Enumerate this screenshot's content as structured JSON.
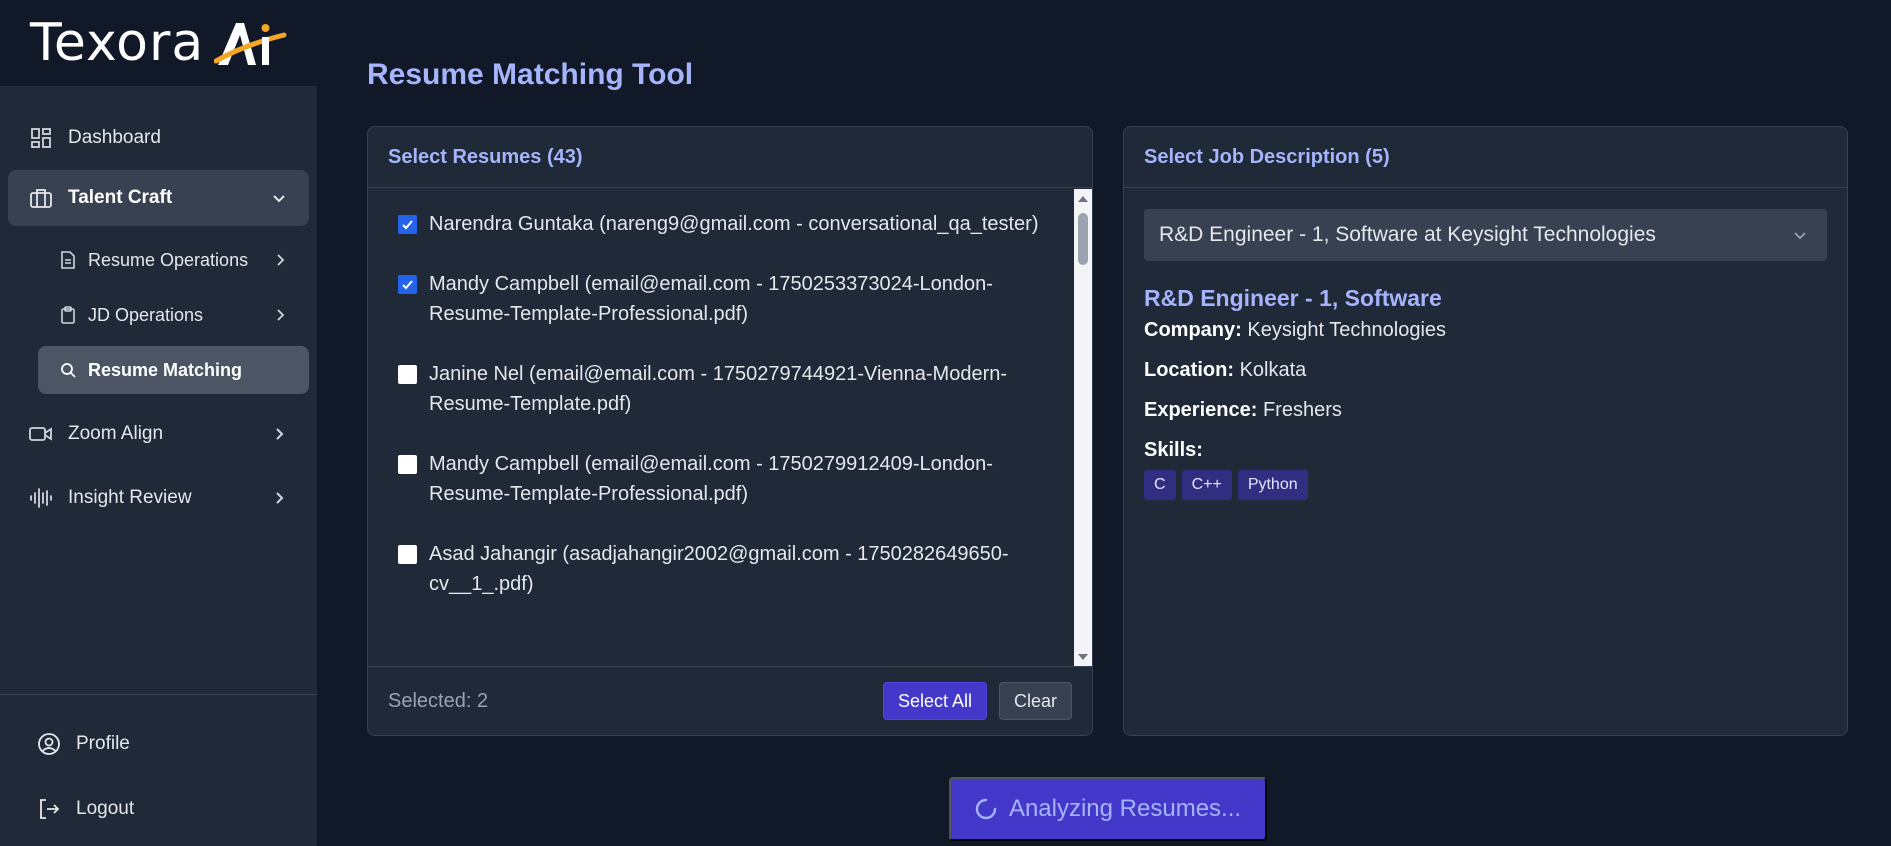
{
  "brand": {
    "name": "Texora",
    "logo_mark": "Ai"
  },
  "sidebar": {
    "items": [
      {
        "label": "Dashboard",
        "icon": "dashboard-icon"
      },
      {
        "label": "Talent Craft",
        "icon": "briefcase-icon",
        "expanded": true
      },
      {
        "label": "Zoom Align",
        "icon": "video-icon"
      },
      {
        "label": "Insight Review",
        "icon": "waveform-icon"
      }
    ],
    "sub_items": [
      {
        "label": "Resume Operations",
        "icon": "file-icon"
      },
      {
        "label": "JD Operations",
        "icon": "clipboard-icon"
      },
      {
        "label": "Resume Matching",
        "icon": "search-icon",
        "current": true
      }
    ],
    "bottom": [
      {
        "label": "Profile",
        "icon": "user-circle-icon"
      },
      {
        "label": "Logout",
        "icon": "logout-icon"
      }
    ]
  },
  "page": {
    "title": "Resume Matching Tool"
  },
  "resumes_panel": {
    "header": "Select Resumes (43)",
    "items": [
      {
        "text": "Narendra Guntaka (nareng9@gmail.com - conversational_qa_tester)",
        "checked": true
      },
      {
        "text": "Mandy Campbell (email@email.com - 1750253373024-London-Resume-Template-Professional.pdf)",
        "checked": true
      },
      {
        "text": "Janine Nel (email@email.com - 1750279744921-Vienna-Modern-Resume-Template.pdf)",
        "checked": false
      },
      {
        "text": "Mandy Campbell (email@email.com - 1750279912409-London-Resume-Template-Professional.pdf)",
        "checked": false
      },
      {
        "text": "Asad Jahangir (asadjahangir2002@gmail.com - 1750282649650-cv__1_.pdf)",
        "checked": false
      }
    ],
    "selected_label": "Selected: 2",
    "select_all_label": "Select All",
    "clear_label": "Clear"
  },
  "jd_panel": {
    "header": "Select Job Description (5)",
    "selected_option": "R&D Engineer - 1, Software at Keysight Technologies",
    "title": "R&D Engineer - 1, Software",
    "company_label": "Company:",
    "company": "Keysight Technologies",
    "location_label": "Location:",
    "location": "Kolkata",
    "experience_label": "Experience:",
    "experience": "Freshers",
    "skills_label": "Skills:",
    "skills": [
      "C",
      "C++",
      "Python"
    ]
  },
  "analyze_button": {
    "label": "Analyzing Resumes..."
  },
  "colors": {
    "accent": "#a5b4fc",
    "primary_button": "#4338ca",
    "checkbox_checked": "#2563eb",
    "logo_accent": "#f5a623"
  }
}
